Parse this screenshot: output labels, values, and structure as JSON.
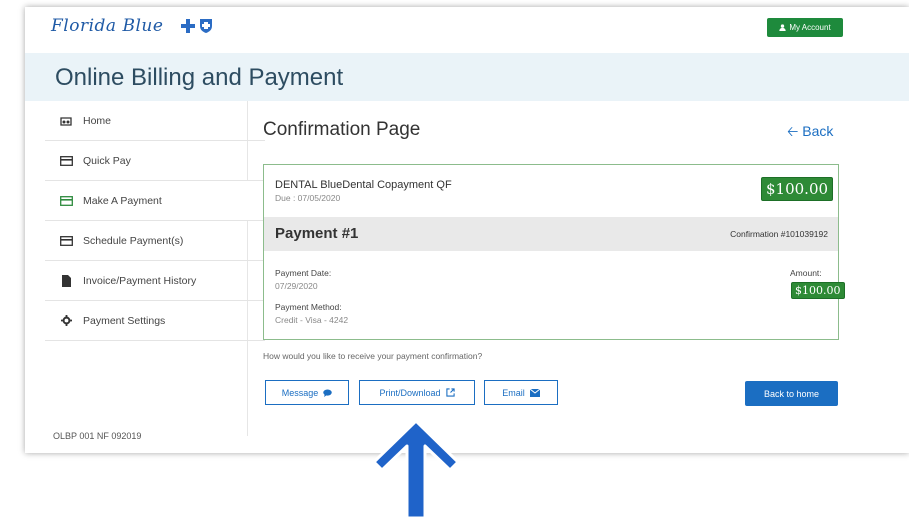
{
  "header": {
    "logo_text": "Florida Blue",
    "account_button": "My Account",
    "banner_title": "Online Billing and Payment"
  },
  "sidebar": {
    "items": [
      {
        "label": "Home",
        "icon": "home-icon"
      },
      {
        "label": "Quick Pay",
        "icon": "card-icon"
      },
      {
        "label": "Make A Payment",
        "icon": "card-icon"
      },
      {
        "label": "Schedule Payment(s)",
        "icon": "card-icon"
      },
      {
        "label": "Invoice/Payment History",
        "icon": "document-icon"
      },
      {
        "label": "Payment Settings",
        "icon": "gear-icon"
      }
    ],
    "active_item": "Make A Payment",
    "footer_code": "OLBP 001 NF 092019"
  },
  "main": {
    "title": "Confirmation Page",
    "back_label": "Back",
    "service_name": "DENTAL BlueDental Copayment QF",
    "due": "Due : 07/05/2020",
    "amount_due": "$100.00",
    "payment_heading": "Payment #1",
    "confirmation": "Confirmation #101039192",
    "payment_date_label": "Payment Date:",
    "payment_date": "07/29/2020",
    "payment_method_label": "Payment Method:",
    "payment_method": "Credit - Visa - 4242",
    "amount_label": "Amount:",
    "amount": "$100.00",
    "question": "How would you like to receive your payment confirmation?",
    "buttons": {
      "message": "Message",
      "print": "Print/Download",
      "email": "Email",
      "back_home": "Back to home"
    }
  },
  "colors": {
    "brand_blue": "#1b6ec2",
    "accent_green": "#2e8a36",
    "banner_bg": "#eaf3f8",
    "arrow_blue": "#1f63c9"
  }
}
